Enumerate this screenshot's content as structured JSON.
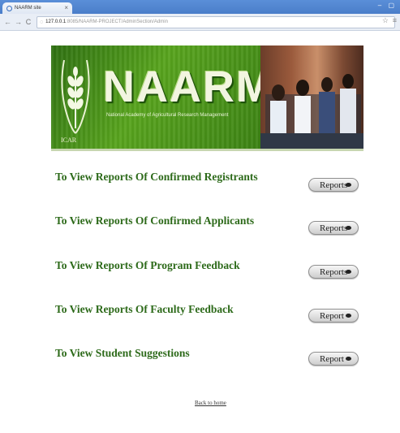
{
  "browser": {
    "tab_title": "NAARM site",
    "tab_close": "×",
    "window_controls": "– ▢",
    "back": "←",
    "forward": "→",
    "reload": "C",
    "url_host": "127.0.0.1",
    "url_path": ":8085/NAARM-PROJECT/AdminSection/Admin",
    "star": "☆",
    "menu": "≡"
  },
  "banner": {
    "brand": "NAARM",
    "tagline": "National Academy of Agricultural Research Management",
    "icar": "ICAR"
  },
  "reports": [
    {
      "label": "To View Reports Of Confirmed Registrants",
      "button": "Reports"
    },
    {
      "label": "To View Reports Of Confirmed Applicants",
      "button": "Reports"
    },
    {
      "label": "To View Reports Of Program Feedback",
      "button": "Reports"
    },
    {
      "label": "To View Reports Of Faculty Feedback",
      "button": "Report"
    },
    {
      "label": "To View Student Suggestions",
      "button": "Report"
    }
  ],
  "footer": {
    "back_link": "Back to home"
  },
  "colors": {
    "label_green": "#2d6a1a",
    "banner_green": "#58a41e",
    "chrome_blue": "#4a7dc9"
  }
}
